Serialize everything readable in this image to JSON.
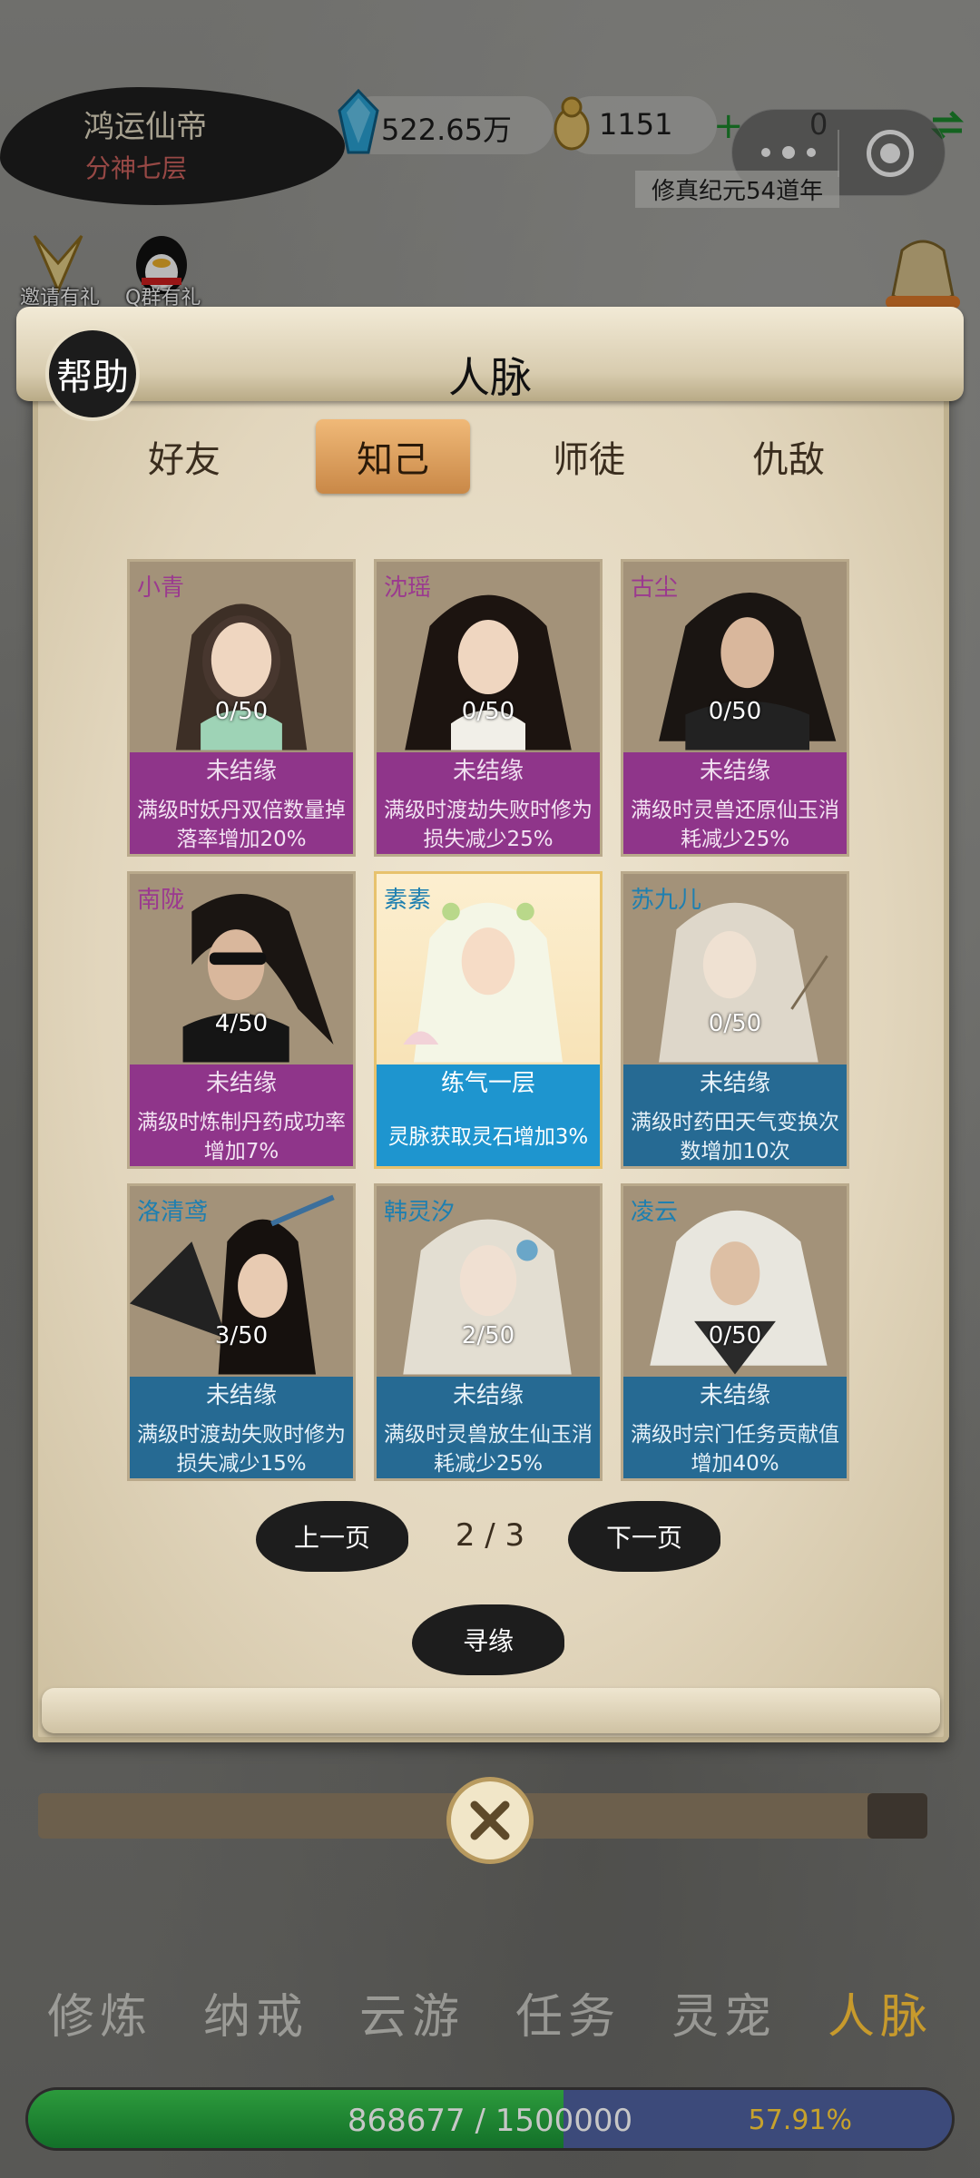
{
  "header": {
    "player_name": "鸿运仙帝",
    "realm": "分神七层",
    "spirit_stones": "522.65万",
    "gold": "1151",
    "plus": "+",
    "extra": "0",
    "era": "修真纪元54道年"
  },
  "gifts": {
    "invite": "邀请有礼",
    "qq": "Q群有礼"
  },
  "dialog": {
    "help": "帮助",
    "title": "人脉",
    "tabs": [
      "好友",
      "知己",
      "师徒",
      "仇敌"
    ],
    "active_tab": 1
  },
  "cards": [
    {
      "name": "小青",
      "progress": "0/50",
      "status": "未结缘",
      "desc": "满级时妖丹双倍数量掉落率增加20%"
    },
    {
      "name": "沈瑶",
      "progress": "0/50",
      "status": "未结缘",
      "desc": "满级时渡劫失败时修为损失减少25%"
    },
    {
      "name": "古尘",
      "progress": "0/50",
      "status": "未结缘",
      "desc": "满级时灵兽还原仙玉消耗减少25%"
    },
    {
      "name": "南陇",
      "progress": "4/50",
      "status": "未结缘",
      "desc": "满级时炼制丹药成功率增加7%"
    },
    {
      "name": "素素",
      "progress": "",
      "status": "练气一层",
      "desc": "灵脉获取灵石增加3%"
    },
    {
      "name": "苏九儿",
      "progress": "0/50",
      "status": "未结缘",
      "desc": "满级时药田天气变换次数增加10次"
    },
    {
      "name": "洛清鸢",
      "progress": "3/50",
      "status": "未结缘",
      "desc": "满级时渡劫失败时修为损失减少15%"
    },
    {
      "name": "韩灵汐",
      "progress": "2/50",
      "status": "未结缘",
      "desc": "满级时灵兽放生仙玉消耗减少25%"
    },
    {
      "name": "凌云",
      "progress": "0/50",
      "status": "未结缘",
      "desc": "满级时宗门任务贡献值增加40%"
    }
  ],
  "pager": {
    "prev": "上一页",
    "page": "2 / 3",
    "next": "下一页",
    "seek": "寻缘"
  },
  "nav": [
    "修炼",
    "纳戒",
    "云游",
    "任务",
    "灵宠",
    "人脉"
  ],
  "nav_active": 5,
  "exp": {
    "text": "868677 / 1500000",
    "percent": "57.91%",
    "fraction": 0.5791
  },
  "colors": {
    "purple": "#8c288c",
    "blue": "#146496",
    "highlight": "#1e95cf",
    "gold": "#c79a2c"
  }
}
